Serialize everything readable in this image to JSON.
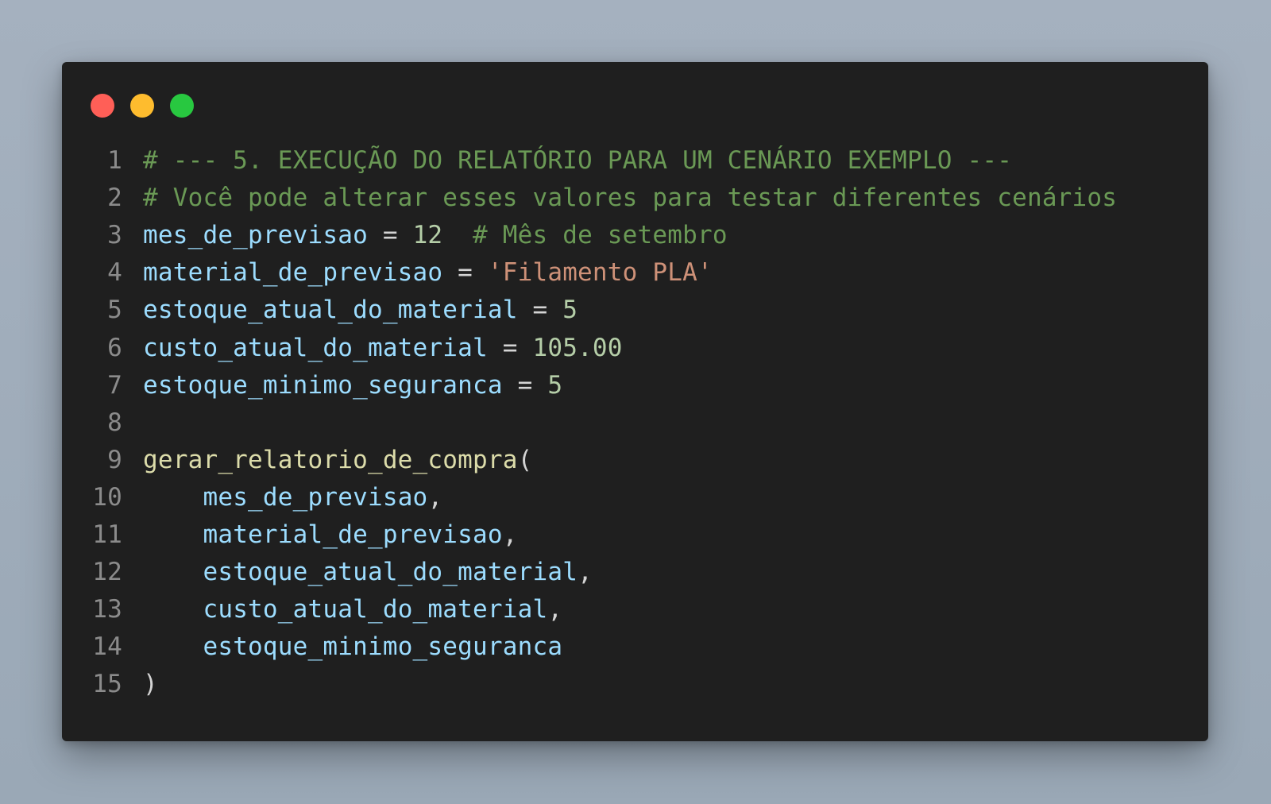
{
  "window": {
    "controls": [
      {
        "name": "close",
        "color": "#ff5f57"
      },
      {
        "name": "minimize",
        "color": "#febc2e"
      },
      {
        "name": "maximize",
        "color": "#28c840"
      }
    ]
  },
  "editor": {
    "lines": [
      {
        "number": "1",
        "tokens": [
          {
            "t": "# --- 5. EXECUÇÃO DO RELATÓRIO PARA UM CENÁRIO EXEMPLO ---",
            "k": "comment"
          }
        ]
      },
      {
        "number": "2",
        "tokens": [
          {
            "t": "# Você pode alterar esses valores para testar diferentes cenários",
            "k": "comment"
          }
        ]
      },
      {
        "number": "3",
        "tokens": [
          {
            "t": "mes_de_previsao",
            "k": "var"
          },
          {
            "t": " = ",
            "k": "op"
          },
          {
            "t": "12",
            "k": "num"
          },
          {
            "t": "  ",
            "k": "op"
          },
          {
            "t": "# Mês de setembro",
            "k": "comment"
          }
        ]
      },
      {
        "number": "4",
        "tokens": [
          {
            "t": "material_de_previsao",
            "k": "var"
          },
          {
            "t": " = ",
            "k": "op"
          },
          {
            "t": "'Filamento PLA'",
            "k": "str"
          }
        ]
      },
      {
        "number": "5",
        "tokens": [
          {
            "t": "estoque_atual_do_material",
            "k": "var"
          },
          {
            "t": " = ",
            "k": "op"
          },
          {
            "t": "5",
            "k": "num"
          }
        ]
      },
      {
        "number": "6",
        "tokens": [
          {
            "t": "custo_atual_do_material",
            "k": "var"
          },
          {
            "t": " = ",
            "k": "op"
          },
          {
            "t": "105.00",
            "k": "num"
          }
        ]
      },
      {
        "number": "7",
        "tokens": [
          {
            "t": "estoque_minimo_seguranca",
            "k": "var"
          },
          {
            "t": " = ",
            "k": "op"
          },
          {
            "t": "5",
            "k": "num"
          }
        ]
      },
      {
        "number": "8",
        "tokens": []
      },
      {
        "number": "9",
        "tokens": [
          {
            "t": "gerar_relatorio_de_compra",
            "k": "fn"
          },
          {
            "t": "(",
            "k": "punc"
          }
        ]
      },
      {
        "number": "10",
        "tokens": [
          {
            "t": "    ",
            "k": "op"
          },
          {
            "t": "mes_de_previsao",
            "k": "var"
          },
          {
            "t": ",",
            "k": "punc"
          }
        ]
      },
      {
        "number": "11",
        "tokens": [
          {
            "t": "    ",
            "k": "op"
          },
          {
            "t": "material_de_previsao",
            "k": "var"
          },
          {
            "t": ",",
            "k": "punc"
          }
        ]
      },
      {
        "number": "12",
        "tokens": [
          {
            "t": "    ",
            "k": "op"
          },
          {
            "t": "estoque_atual_do_material",
            "k": "var"
          },
          {
            "t": ",",
            "k": "punc"
          }
        ]
      },
      {
        "number": "13",
        "tokens": [
          {
            "t": "    ",
            "k": "op"
          },
          {
            "t": "custo_atual_do_material",
            "k": "var"
          },
          {
            "t": ",",
            "k": "punc"
          }
        ]
      },
      {
        "number": "14",
        "tokens": [
          {
            "t": "    ",
            "k": "op"
          },
          {
            "t": "estoque_minimo_seguranca",
            "k": "var"
          }
        ]
      },
      {
        "number": "15",
        "tokens": [
          {
            "t": ")",
            "k": "punc"
          }
        ]
      }
    ]
  }
}
